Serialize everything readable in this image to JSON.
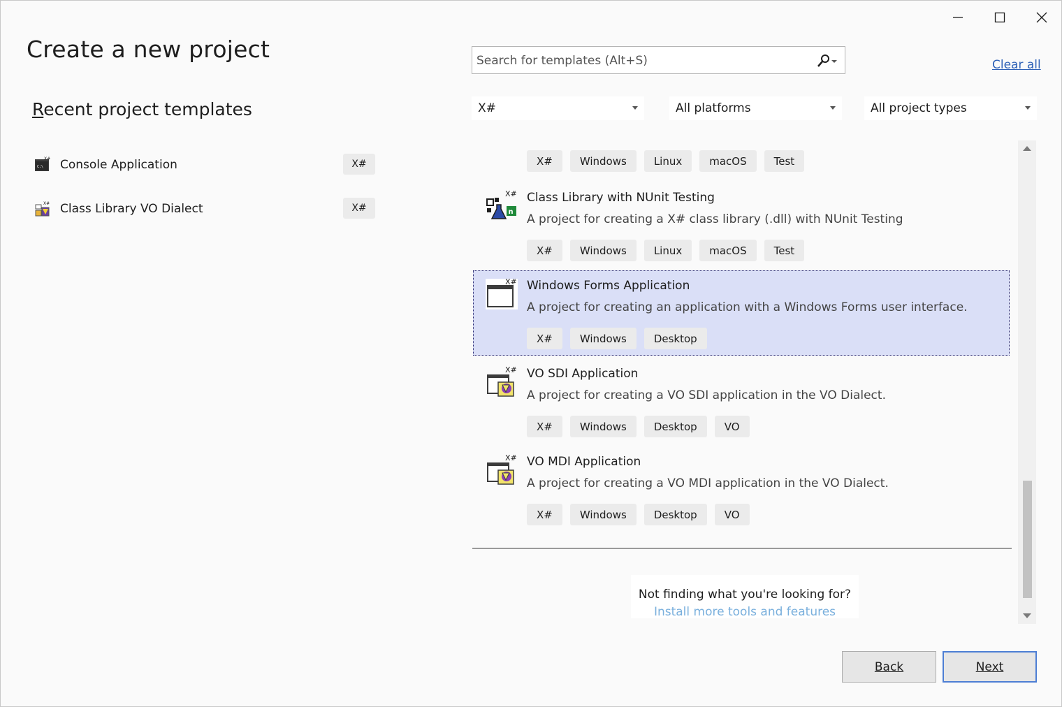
{
  "window": {
    "controls": [
      "minimize",
      "maximize",
      "close"
    ]
  },
  "page": {
    "title": "Create a new project",
    "recent_heading_first": "R",
    "recent_heading_rest": "ecent project templates"
  },
  "recent": [
    {
      "name": "Console Application",
      "lang": "X#",
      "icon": "console-app-icon"
    },
    {
      "name": "Class Library VO Dialect",
      "lang": "X#",
      "icon": "class-library-icon"
    }
  ],
  "search": {
    "placeholder": "Search for templates (Alt+S)",
    "clear_all": "Clear all"
  },
  "filters": {
    "language": "X#",
    "platform": "All platforms",
    "project_type": "All project types"
  },
  "templates": [
    {
      "tags": [
        "X#",
        "Windows",
        "Linux",
        "macOS",
        "Test"
      ]
    },
    {
      "name": "Class Library with NUnit Testing",
      "description": "A project for creating a X# class library (.dll) with NUnit Testing",
      "tags": [
        "X#",
        "Windows",
        "Linux",
        "macOS",
        "Test"
      ],
      "icon": "nunit-library-icon"
    },
    {
      "name": "Windows Forms Application",
      "description": "A project for creating an application with a Windows Forms user interface.",
      "tags": [
        "X#",
        "Windows",
        "Desktop"
      ],
      "icon": "windows-forms-icon",
      "selected": true
    },
    {
      "name": "VO SDI Application",
      "description": "A project for creating a VO SDI application in the VO Dialect.",
      "tags": [
        "X#",
        "Windows",
        "Desktop",
        "VO"
      ],
      "icon": "vo-sdi-icon"
    },
    {
      "name": "VO MDI Application",
      "description": "A project for creating a VO MDI application in the VO Dialect.",
      "tags": [
        "X#",
        "Windows",
        "Desktop",
        "VO"
      ],
      "icon": "vo-mdi-icon"
    }
  ],
  "not_finding": {
    "question": "Not finding what you're looking for?",
    "link": "Install more tools and features"
  },
  "buttons": {
    "back": "Back",
    "next": "Next"
  },
  "colors": {
    "selected_bg": "#dadff7",
    "link": "#2f62b7",
    "next_border": "#4d7ed4"
  }
}
